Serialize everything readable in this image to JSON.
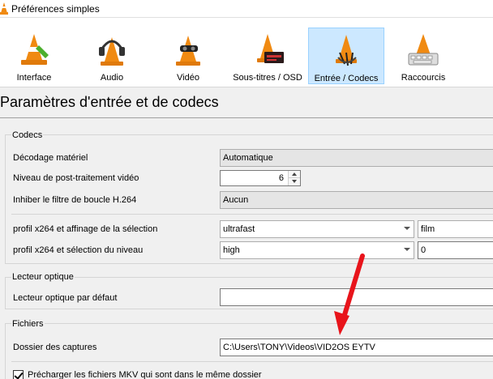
{
  "window": {
    "title": "Préférences simples"
  },
  "toolbar": {
    "items": [
      {
        "label": "Interface",
        "icon": "interface-cone-icon"
      },
      {
        "label": "Audio",
        "icon": "audio-cone-icon"
      },
      {
        "label": "Vidéo",
        "icon": "video-cone-icon"
      },
      {
        "label": "Sous-titres / OSD",
        "icon": "subtitles-cone-icon"
      },
      {
        "label": "Entrée / Codecs",
        "icon": "codecs-cone-icon",
        "selected": true
      },
      {
        "label": "Raccourcis",
        "icon": "hotkeys-cone-icon"
      }
    ]
  },
  "page": {
    "heading": "Paramètres d'entrée et de codecs"
  },
  "codecs": {
    "title": "Codecs",
    "hw_decoding_label": "Décodage matériel",
    "hw_decoding_value": "Automatique",
    "postproc_label": "Niveau de post-traitement vidéo",
    "postproc_value": "6",
    "loopfilter_label": "Inhiber le filtre de boucle H.264",
    "loopfilter_value": "Aucun",
    "x264_preset_label": "profil x264 et affinage de la sélection",
    "x264_preset_value": "ultrafast",
    "x264_tune_value": "film",
    "x264_profile_label": "profil x264 et sélection du niveau",
    "x264_profile_value": "high",
    "x264_level_value": "0"
  },
  "optical": {
    "title": "Lecteur optique",
    "default_label": "Lecteur optique par défaut",
    "default_value": ""
  },
  "files": {
    "title": "Fichiers",
    "record_dir_label": "Dossier des captures",
    "record_dir_value": "C:\\Users\\TONY\\Videos\\VID2OS EYTV",
    "mkv_preload_label": "Précharger les fichiers MKV qui sont dans le même dossier",
    "mkv_preload_checked": true
  },
  "colors": {
    "annotation_arrow": "#e8141b",
    "selected_tab_bg": "#cce8ff"
  }
}
